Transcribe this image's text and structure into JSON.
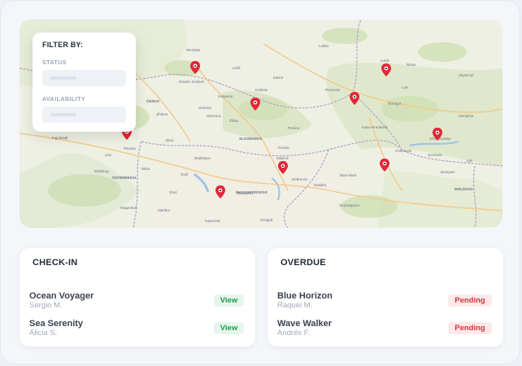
{
  "filter": {
    "title": "FILTER BY:",
    "status_label": "STATUS",
    "availability_label": "AVAILABILITY"
  },
  "map": {
    "labels": [
      "Wrocław",
      "Łódź",
      "Lublin",
      "Kielce",
      "Lviv",
      "Kraków",
      "Katowice",
      "Ostrava",
      "Praha",
      "Brno",
      "Bratislava",
      "Wien",
      "Linz",
      "Salzburg",
      "ÖSTERREICH",
      "SLOVENSKO",
      "ČESKO",
      "Budapest",
      "MAGYARORSZÁG",
      "Debrecen",
      "Miskolc",
      "Cluj-Napoca",
      "Chernivtsi",
      "Ivano-Frankivsk",
      "Rzeszów",
      "Ternopil",
      "Rivne",
      "Lutsk",
      "Kosice",
      "Graz",
      "Klagenfurt",
      "Szeged",
      "Oradea",
      "Iași",
      "Suceava",
      "Zhytomyr",
      "Botoșani",
      "MOLDOVA",
      "Vinnytsia",
      "Baia Mare",
      "Győr",
      "Kaposvár",
      "Maribor",
      "Ingolstadt",
      "Regensburg",
      "Passau",
      "Jihlava",
      "Hradec Králové",
      "Olomouc",
      "Žilina",
      "Prešov",
      "Khmelnytskyi"
    ],
    "pins": 10
  },
  "checkin": {
    "title": "CHECK-IN",
    "items": [
      {
        "name": "Ocean Voyager",
        "person": "Sergio M.",
        "action": "View"
      },
      {
        "name": "Sea Serenity",
        "person": "Alicia S.",
        "action": "View"
      }
    ]
  },
  "overdue": {
    "title": "OVERDUE",
    "items": [
      {
        "name": "Blue Horizon",
        "person": "Raquel M.",
        "status": "Pending"
      },
      {
        "name": "Wave Walker",
        "person": "Andrés F.",
        "status": "Pending"
      }
    ]
  },
  "colors": {
    "pin": "#e32636",
    "view_bg": "#e7f6ec",
    "view_text": "#1f9a4f",
    "pending_bg": "#fde9ea",
    "pending_text": "#e0313a"
  }
}
